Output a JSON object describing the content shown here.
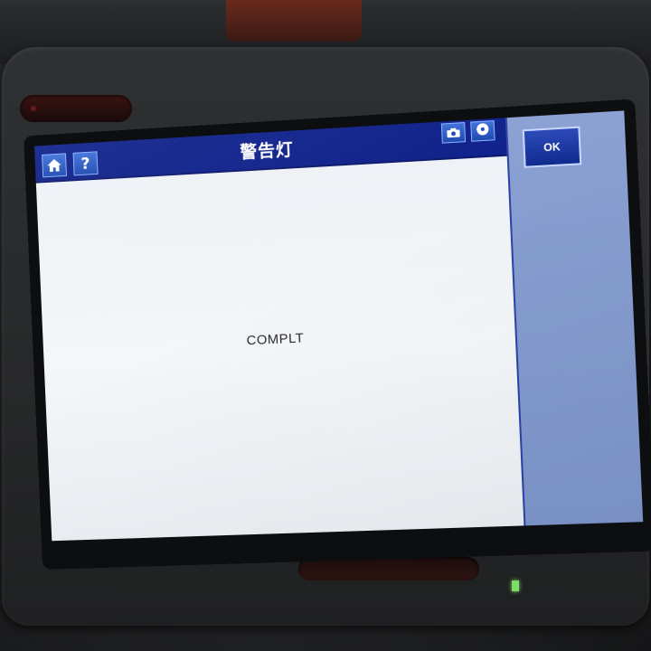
{
  "header": {
    "title": "警告灯"
  },
  "icons": {
    "home": "home-icon",
    "help": "help-icon",
    "camera": "camera-icon",
    "disc": "disc-icon"
  },
  "help_glyph": "?",
  "content": {
    "status_text": "COMPLT"
  },
  "side_panel": {
    "ok_label": "OK"
  },
  "colors": {
    "header_bar": "#0d1f8a",
    "side_panel": "#8aa0d2",
    "button": "#1c47b0",
    "screen_background": "#f2f4f7"
  }
}
